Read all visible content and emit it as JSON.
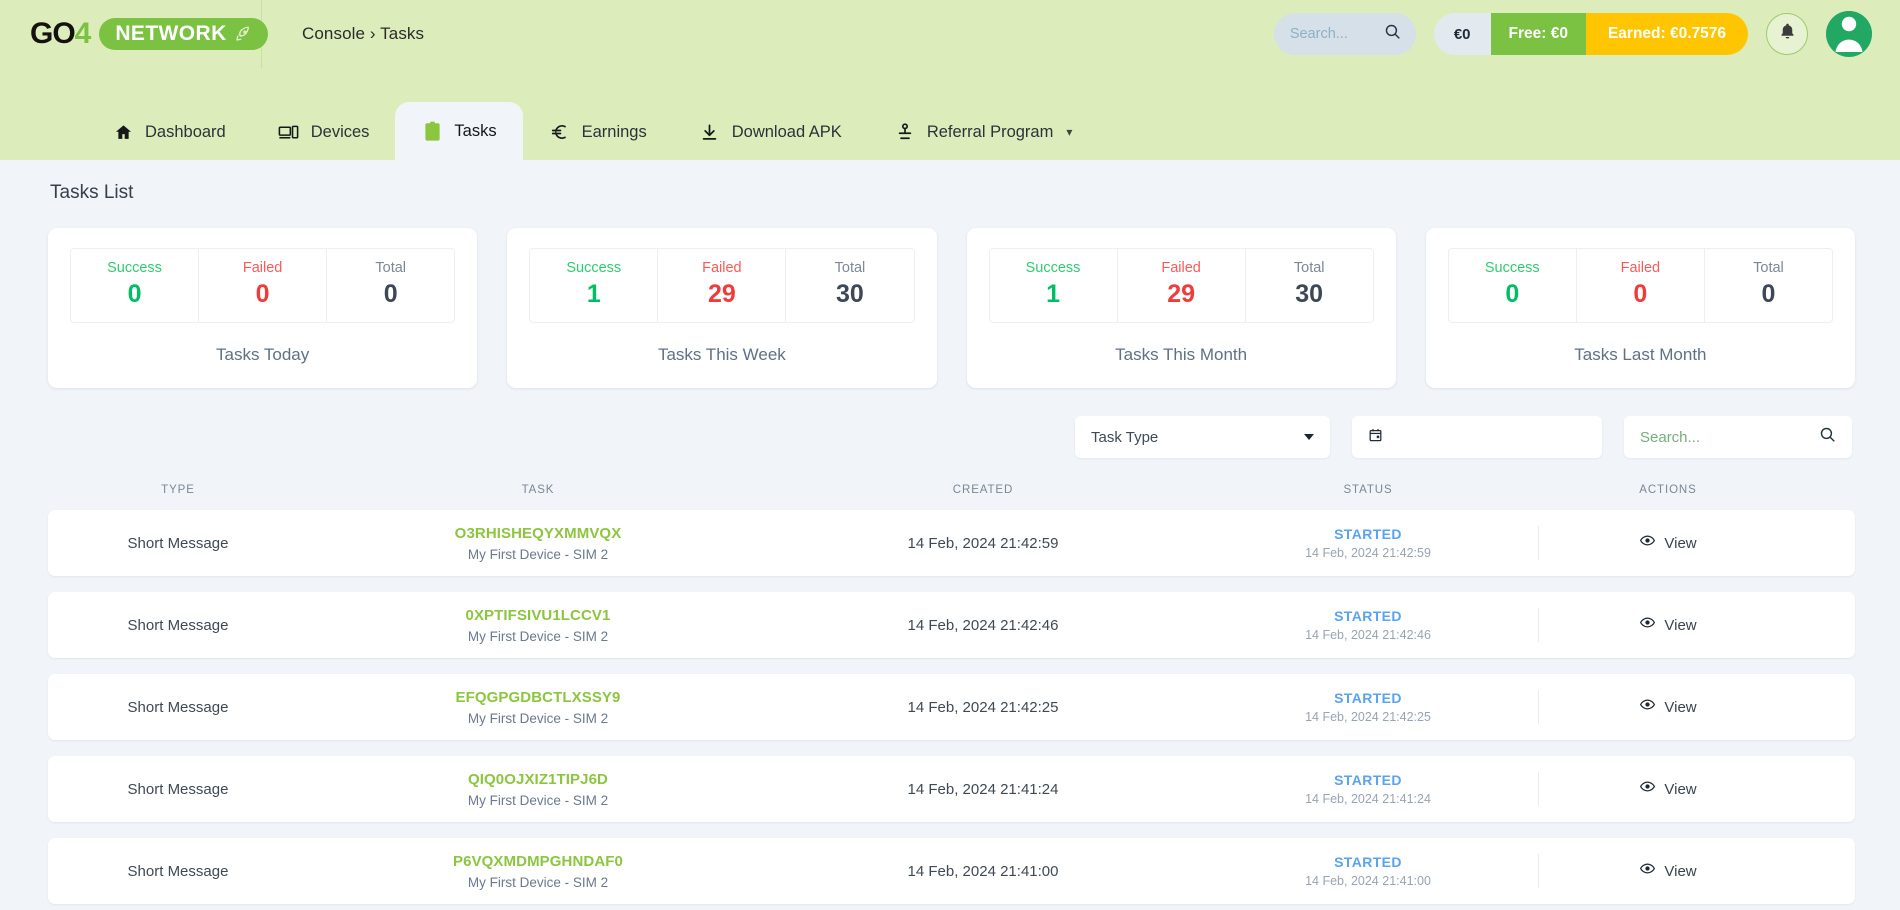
{
  "header": {
    "logo": {
      "go": "GO",
      "four": "4",
      "network": "NETWORK",
      "rocket_icon": "rocket-icon"
    },
    "breadcrumb": "Console › Tasks",
    "search": {
      "placeholder": "Search...",
      "value": "",
      "icon": "search-icon"
    },
    "balance": {
      "cash": "€0",
      "free": "Free: €0",
      "earned": "Earned: €0.7576"
    },
    "notifications_icon": "bell-icon",
    "avatar_icon": "user-avatar-icon"
  },
  "nav": {
    "tabs": [
      {
        "label": "Dashboard",
        "icon": "home-icon",
        "active": false,
        "caret": false
      },
      {
        "label": "Devices",
        "icon": "devices-icon",
        "active": false,
        "caret": false
      },
      {
        "label": "Tasks",
        "icon": "clipboard-icon",
        "active": true,
        "caret": false
      },
      {
        "label": "Earnings",
        "icon": "euro-icon",
        "active": false,
        "caret": false
      },
      {
        "label": "Download APK",
        "icon": "download-icon",
        "active": false,
        "caret": false
      },
      {
        "label": "Referral Program",
        "icon": "person-share-icon",
        "active": false,
        "caret": true
      }
    ]
  },
  "page": {
    "title": "Tasks List"
  },
  "stat_cards": [
    {
      "caption": "Tasks Today",
      "cells": [
        {
          "label": "Success",
          "value": "0",
          "kind": "success"
        },
        {
          "label": "Failed",
          "value": "0",
          "kind": "failed"
        },
        {
          "label": "Total",
          "value": "0",
          "kind": "total"
        }
      ]
    },
    {
      "caption": "Tasks This Week",
      "cells": [
        {
          "label": "Success",
          "value": "1",
          "kind": "success"
        },
        {
          "label": "Failed",
          "value": "29",
          "kind": "failed"
        },
        {
          "label": "Total",
          "value": "30",
          "kind": "total"
        }
      ]
    },
    {
      "caption": "Tasks This Month",
      "cells": [
        {
          "label": "Success",
          "value": "1",
          "kind": "success"
        },
        {
          "label": "Failed",
          "value": "29",
          "kind": "failed"
        },
        {
          "label": "Total",
          "value": "30",
          "kind": "total"
        }
      ]
    },
    {
      "caption": "Tasks Last Month",
      "cells": [
        {
          "label": "Success",
          "value": "0",
          "kind": "success"
        },
        {
          "label": "Failed",
          "value": "0",
          "kind": "failed"
        },
        {
          "label": "Total",
          "value": "0",
          "kind": "total"
        }
      ]
    }
  ],
  "filters": {
    "task_type": {
      "label": "Task Type",
      "value": "",
      "caret_icon": "chevron-down-icon"
    },
    "date": {
      "value": "",
      "icon": "calendar-icon"
    },
    "search": {
      "placeholder": "Search...",
      "value": "",
      "icon": "search-icon"
    }
  },
  "table": {
    "headers": [
      "TYPE",
      "TASK",
      "CREATED",
      "STATUS",
      "ACTIONS"
    ],
    "action_label": "View",
    "action_icon": "eye-icon",
    "rows": [
      {
        "type": "Short Message",
        "task_code": "O3RHISHEQYXMMVQX",
        "task_sub": "My First Device - SIM 2",
        "created": "14 Feb, 2024 21:42:59",
        "status": "STARTED",
        "status_time": "14 Feb, 2024 21:42:59"
      },
      {
        "type": "Short Message",
        "task_code": "0XPTIFSIVU1LCCV1",
        "task_sub": "My First Device - SIM 2",
        "created": "14 Feb, 2024 21:42:46",
        "status": "STARTED",
        "status_time": "14 Feb, 2024 21:42:46"
      },
      {
        "type": "Short Message",
        "task_code": "EFQGPGDBCTLXSSY9",
        "task_sub": "My First Device - SIM 2",
        "created": "14 Feb, 2024 21:42:25",
        "status": "STARTED",
        "status_time": "14 Feb, 2024 21:42:25"
      },
      {
        "type": "Short Message",
        "task_code": "QIQ0OJXIZ1TIPJ6D",
        "task_sub": "My First Device - SIM 2",
        "created": "14 Feb, 2024 21:41:24",
        "status": "STARTED",
        "status_time": "14 Feb, 2024 21:41:24"
      },
      {
        "type": "Short Message",
        "task_code": "P6VQXMDMPGHNDAF0",
        "task_sub": "My First Device - SIM 2",
        "created": "14 Feb, 2024 21:41:00",
        "status": "STARTED",
        "status_time": "14 Feb, 2024 21:41:00"
      }
    ]
  },
  "colors": {
    "brand_green": "#7cc242",
    "header_bg": "#dcedbb",
    "page_bg": "#f1f5f9",
    "accent_yellow": "#ffc600",
    "success": "#00bf63",
    "failed": "#f03b3b",
    "status_blue": "#5aa3f0",
    "task_code_green": "#8cc63f"
  }
}
